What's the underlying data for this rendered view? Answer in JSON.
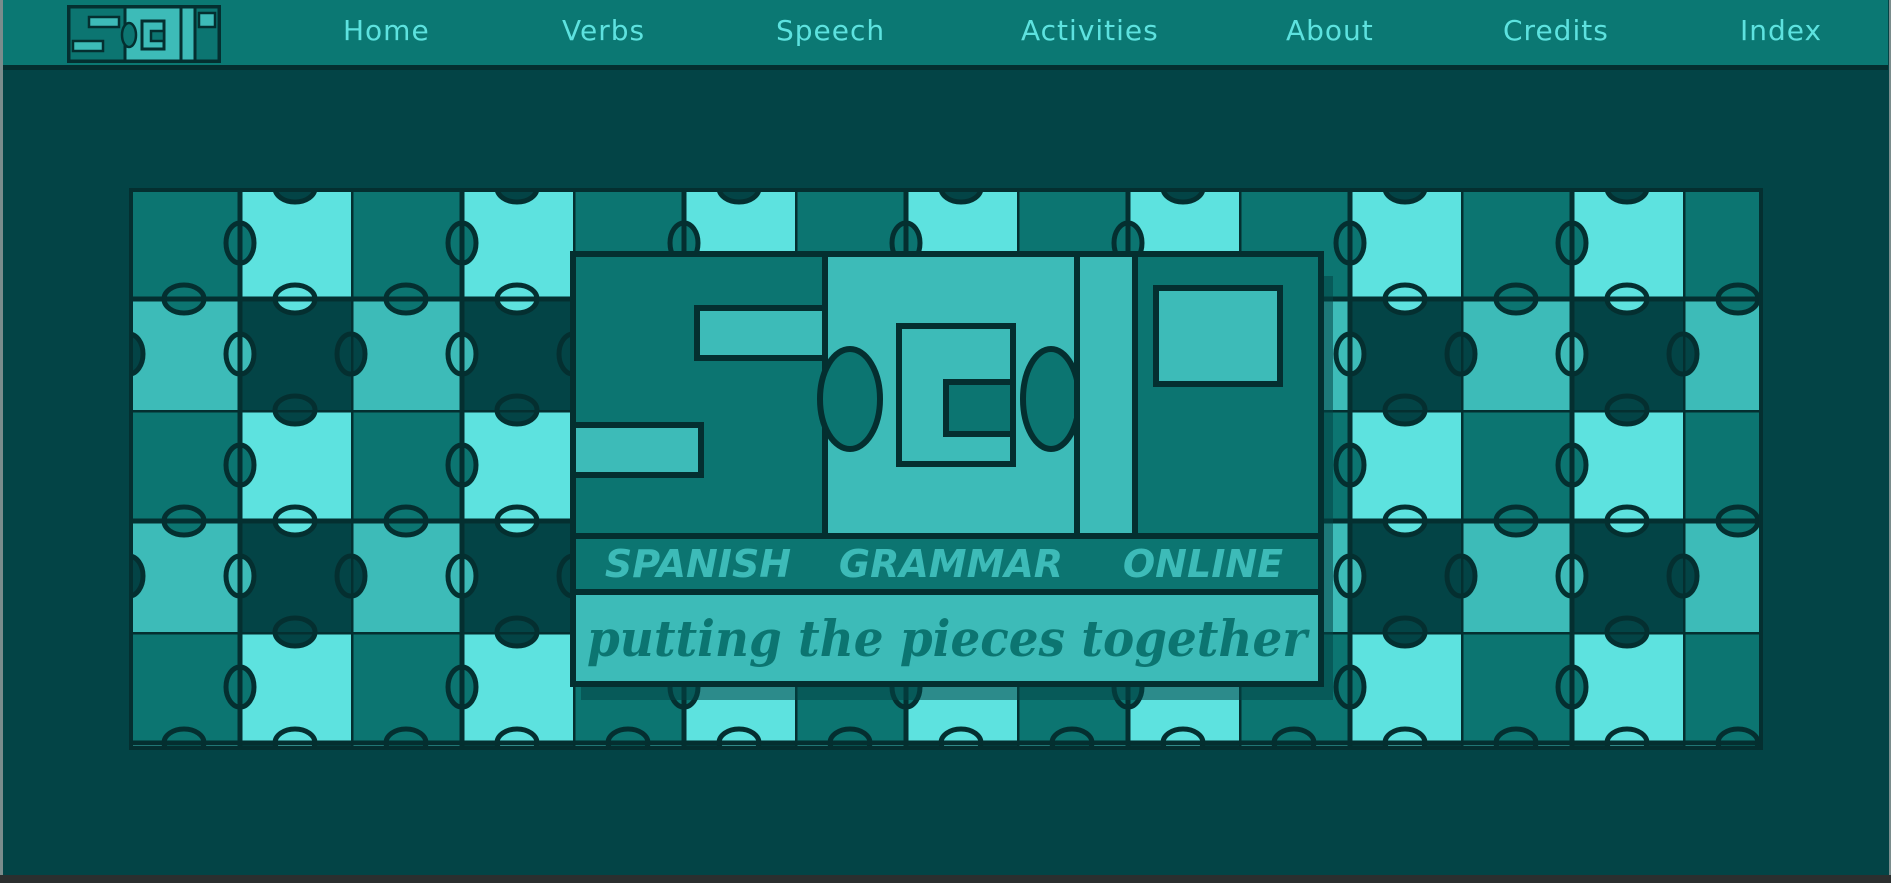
{
  "logo": {
    "lettering": "SGO",
    "alt": "SGO logo"
  },
  "nav": {
    "links": [
      {
        "label": "Home"
      },
      {
        "label": "Verbs"
      },
      {
        "label": "Speech"
      },
      {
        "label": "Activities"
      },
      {
        "label": "About"
      },
      {
        "label": "Credits"
      },
      {
        "label": "Index"
      }
    ]
  },
  "hero": {
    "words": [
      "SPANISH",
      "GRAMMAR",
      "ONLINE"
    ],
    "tagline": "putting the pieces together"
  },
  "colors": {
    "background": "#034446",
    "navbar": "#0b7873",
    "nav_text": "#5de2df",
    "piece_light": "#5de2df",
    "piece_mid": "#3dbbb8",
    "piece_teal": "#0c7571",
    "piece_dark": "#034446",
    "outline": "#042f30"
  }
}
